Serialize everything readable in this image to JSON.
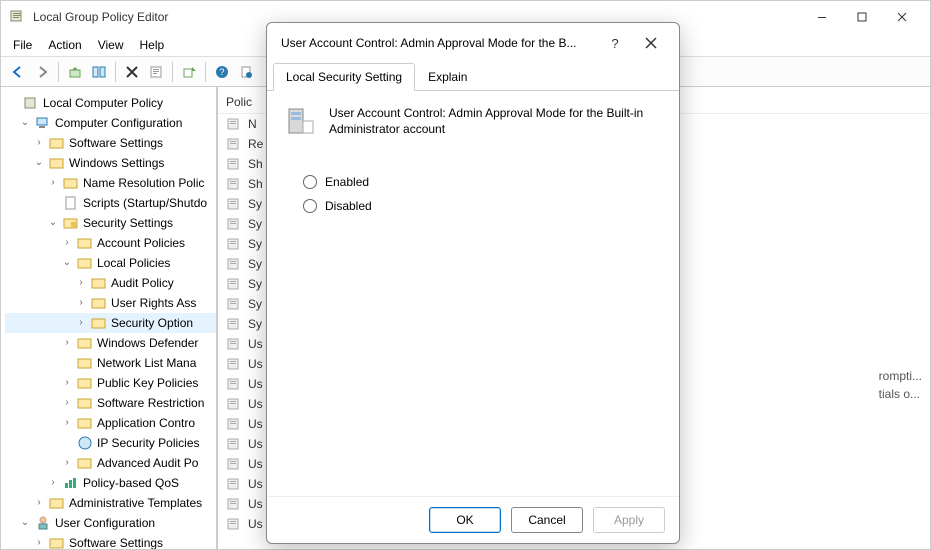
{
  "window": {
    "title": "Local Group Policy Editor"
  },
  "menu": {
    "file": "File",
    "action": "Action",
    "view": "View",
    "help": "Help"
  },
  "tree": {
    "root": "Local Computer Policy",
    "cc": "Computer Configuration",
    "ss1": "Software Settings",
    "ws": "Windows Settings",
    "nrp": "Name Resolution Polic",
    "scripts": "Scripts (Startup/Shutdo",
    "sec": "Security Settings",
    "acct": "Account Policies",
    "local": "Local Policies",
    "audit": "Audit Policy",
    "ura": "User Rights Ass",
    "secopt": "Security Option",
    "wdf": "Windows Defender",
    "nlm": "Network List Mana",
    "pkp": "Public Key Policies",
    "srp": "Software Restriction",
    "acp": "Application Contro",
    "ips": "IP Security Policies",
    "aap": "Advanced Audit Po",
    "qos": "Policy-based QoS",
    "at": "Administrative Templates",
    "uc": "User Configuration",
    "ss2": "Software Settings"
  },
  "list": {
    "header": "Polic",
    "rows": [
      "N",
      "Re",
      "Sh",
      "Sh",
      "Sy",
      "Sy",
      "Sy",
      "Sy",
      "Sy",
      "Sy",
      "Sy",
      "Us",
      "Us",
      "Us",
      "Us",
      "Us",
      "Us",
      "Us",
      "Us",
      "Us",
      "Us"
    ],
    "peek": {
      "a": "rompti...",
      "b": "tials o..."
    }
  },
  "dialog": {
    "title": "User Account Control: Admin Approval Mode for the B...",
    "tab1": "Local Security Setting",
    "tab2": "Explain",
    "policyName": "User Account Control: Admin Approval Mode for the Built-in Administrator account",
    "optEnabled": "Enabled",
    "optDisabled": "Disabled",
    "ok": "OK",
    "cancel": "Cancel",
    "apply": "Apply"
  }
}
